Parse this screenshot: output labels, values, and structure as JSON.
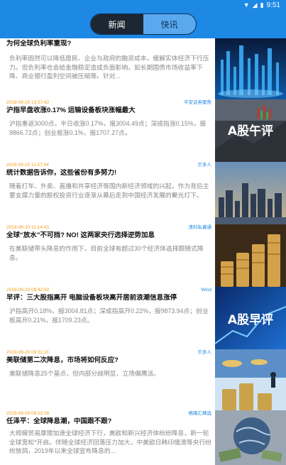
{
  "status": {
    "time": "9:51"
  },
  "tabs": [
    {
      "label": "新闻",
      "active": true
    },
    {
      "label": "快讯",
      "active": false
    }
  ],
  "feed": [
    {
      "time": "",
      "source": "",
      "title": "为何全球负利率重现?",
      "summary": "负利率固然可以降低居民、企业与政府的融资成本，缓解实体经济下行压力。但负利率也会给金融稳定造成负面影响，如长期国债市场收益率下降、商业银行盈利空间被压缩等。针对..."
    },
    {
      "time": "2019-09-20 13:57:42",
      "source": "平安证券聚焦",
      "title": "沪指早盘收涨0.17% 运输设备板块涨幅最大",
      "summary": "沪指重返3000点，半日收涨0.17%，报3004.49点；深成指涨0.15%，报9866.72点；创业板涨0.1%，报1707.27点。"
    },
    {
      "time": "2019-09-20 11:57:54",
      "source": "贝多人",
      "title": "统计数据告诉你，这些省份有多努力!",
      "summary": "随着打车、外卖、直播和共享经济等国内新经济领域的兴起，作为背后主要支撑力量的股权投资行业逐渐从幕后走到中国经济发展的聚光灯下。"
    },
    {
      "time": "2019-09-20 11:14:43",
      "source": "清科私募通",
      "title": "全球“放水”不可挡? NO! 这两家央行选择逆势加息",
      "summary": "在美联储带头降息的作用下，目前全球有超过30个经济体选择跟随式降息。"
    },
    {
      "time": "2019-09-20 09:42:50",
      "source": "Wind",
      "title": "早评：三大股指高开 电脑设备板块高开居前浪潮信息涨停",
      "summary": "沪指高开0.18%，报3004.81点；深成指高开0.22%，报9873.94点；创业板高开0.21%，报1709.23点。"
    },
    {
      "time": "2019-09-20 09:31:21",
      "source": "贝多人",
      "title": "美联储第二次降息，市场将如何反应?",
      "summary": "美联储降息25个基点，但内部分歧明显，立场偏鹰派。"
    },
    {
      "time": "2019-09-20 09:22:26",
      "source": "格隆汇精选",
      "title": "任泽平：全球降息潮，中国跟不跟?",
      "summary": "大规模贸易摩擦加速全球经济下行，美欧和新兴经济体纷纷降息，新一轮全球宽松*开启。伴随全球经济回落压力加大，中美欧日韩印俄澳等央行纷纷放鸽，2019年以来全球宣布降息的..."
    }
  ],
  "thumbnails": [
    {
      "name": "thumb-tech-city",
      "caption": ""
    },
    {
      "name": "thumb-afternoon-review",
      "caption": "A股午评"
    },
    {
      "name": "thumb-city-skyline",
      "caption": ""
    },
    {
      "name": "thumb-coin-stacks",
      "caption": ""
    },
    {
      "name": "thumb-morning-review",
      "caption": "A股早评"
    },
    {
      "name": "thumb-coins-businessman",
      "caption": ""
    },
    {
      "name": "thumb-globe-money",
      "caption": ""
    }
  ],
  "colors": {
    "accent": "#1e88e5",
    "time": "#f39c12",
    "source": "#1e88e5",
    "tab_active_bg": "#1c2733"
  }
}
